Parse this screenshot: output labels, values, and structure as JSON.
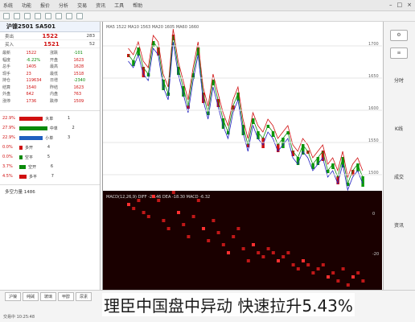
{
  "app": {
    "menu": [
      "系统",
      "功能",
      "报价",
      "分析",
      "交易",
      "资讯",
      "工具",
      "帮助"
    ],
    "window_buttons": [
      "–",
      "□",
      "×"
    ]
  },
  "left_panel": {
    "title": "沪镍2501 SA501",
    "orderbook": [
      {
        "label": "卖出",
        "value": "1522",
        "vol": "283"
      },
      {
        "label": "买入",
        "value": "1521",
        "vol": "52"
      }
    ],
    "quote_rows": [
      [
        "最新",
        "1522",
        "涨跌",
        "-101"
      ],
      [
        "幅度",
        "-6.22%",
        "开盘",
        "1623"
      ],
      [
        "总手",
        "1405",
        "最高",
        "1628"
      ],
      [
        "现手",
        "23",
        "最低",
        "1518"
      ],
      [
        "持仓",
        "119634",
        "日增",
        "-2340"
      ],
      [
        "结算",
        "1540",
        "昨结",
        "1623"
      ],
      [
        "外盘",
        "642",
        "内盘",
        "763"
      ],
      [
        "涨停",
        "1736",
        "跌停",
        "1509"
      ]
    ],
    "flows": [
      {
        "pct": "22.9%",
        "name": "大单",
        "n": "1"
      },
      {
        "pct": "27.9%",
        "name": "中单",
        "n": "2"
      },
      {
        "pct": "22.9%",
        "name": "小单",
        "n": "3"
      },
      {
        "pct": "0.0%",
        "name": "多开",
        "n": "4"
      },
      {
        "pct": "0.0%",
        "name": "空平",
        "n": "5"
      },
      {
        "pct": "3.7%",
        "name": "空开",
        "n": "6"
      },
      {
        "pct": "4.5%",
        "name": "多平",
        "n": "7"
      }
    ],
    "footer": "多空力量 1486"
  },
  "chart": {
    "header": "MA5 1522 MA10 1563 MA20 1605 MA60 1660",
    "macd_header": "MACD(12,26,9) DIFF -21.46 DEA -18.30 MACD -6.32",
    "price_ticks": [
      "1700",
      "1650",
      "1600",
      "1550",
      "1500"
    ],
    "sub_ticks": [
      "0",
      "-20"
    ]
  },
  "sidebar": {
    "tabs": [
      "分时",
      "K线",
      "成交",
      "资讯"
    ]
  },
  "bottom": {
    "tabs": [
      "沪镍",
      "纯碱",
      "玻璃",
      "甲醇",
      "尿素"
    ],
    "status": "交易中 10:25:48"
  },
  "headline": "理臣中国盘中异动 快速拉升5.43%",
  "colors": {
    "up": "#d01010",
    "down": "#0a8a0a",
    "bg_sub": "#1a0000"
  }
}
